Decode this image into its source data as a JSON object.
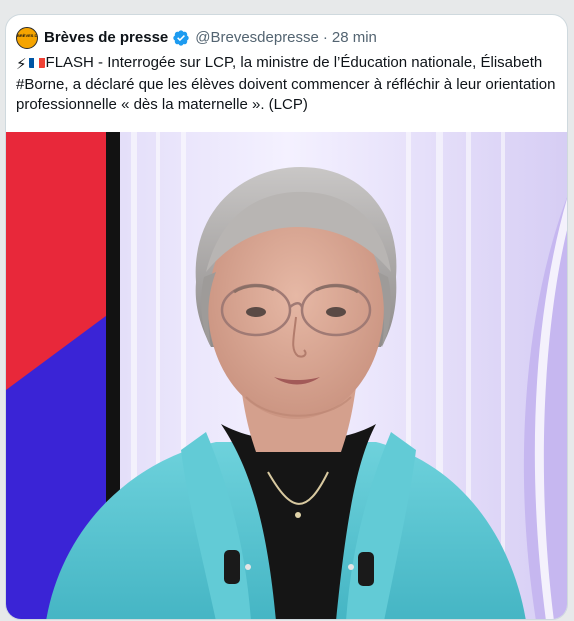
{
  "tweet": {
    "avatar_text": "BRÈVES DE PRESSE",
    "display_name": "Brèves de presse",
    "handle": "@Brevesdepresse",
    "separator": "·",
    "time": "28 min",
    "lightning_emoji": "⚡",
    "text": "FLASH - Interrogée sur LCP, la ministre de l’Éducation nationale, Élisabeth #Borne, a déclaré que les élèves doivent commencer à réfléchir à leur orientation professionnelle « dès la maternelle ». (LCP)",
    "media_icon": "portrait-photo"
  },
  "colors": {
    "verified_blue": "#1d9bf0",
    "handle_gray": "#536471",
    "text": "#0f1419",
    "jacket": "#5cc6d2",
    "flag_blue": "#0055a4",
    "flag_red": "#ef4135"
  }
}
